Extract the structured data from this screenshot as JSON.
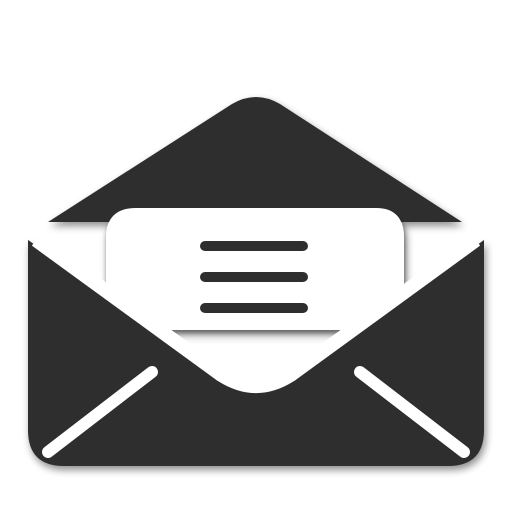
{
  "icon": {
    "name": "open-envelope-icon",
    "colors": {
      "body": "#2e2e2e",
      "flap": "#2e2e2e",
      "letter": "#ffffff",
      "letter_lines": "#2e2e2e",
      "background": "#ffffff",
      "shadow": "#000000"
    },
    "letter_line_count": 3
  }
}
